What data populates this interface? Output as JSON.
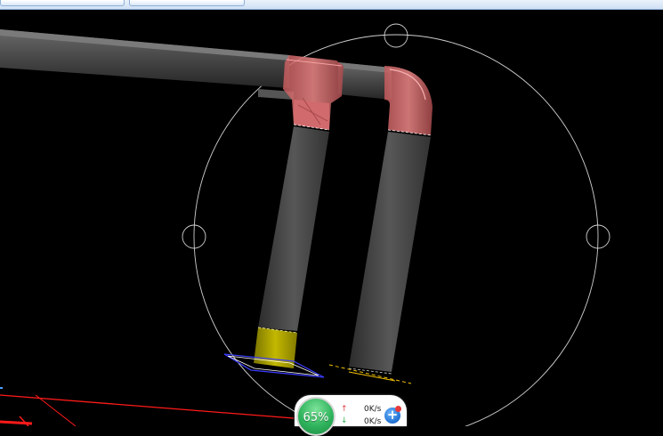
{
  "tabs": [
    {
      "label": ""
    },
    {
      "label": ""
    }
  ],
  "viewport": {
    "background_color": "#000000",
    "orbit_color": "#d0d0d0",
    "pipe_color": "#3e3e3e",
    "elbow_color": "#e86f70",
    "selected_color": "#b6ad00",
    "axis_color": "#ff0000",
    "grip_color": "#f0c000",
    "selection_color": "#3c3cff"
  },
  "network_monitor": {
    "cpu_percent": "65%",
    "upload_speed": "0K/s",
    "download_speed": "0K/s",
    "up_arrow_icon": "↑",
    "down_arrow_icon": "↓",
    "accelerate_icon": "+"
  }
}
